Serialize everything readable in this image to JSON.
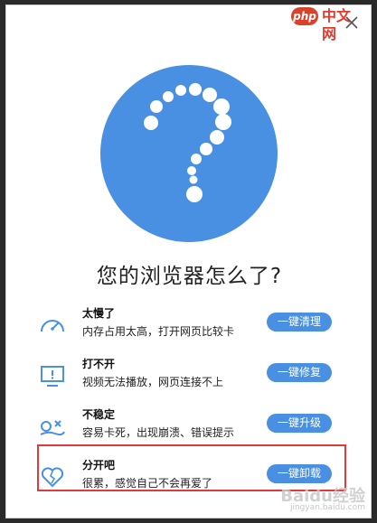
{
  "window": {
    "close_label": "✕"
  },
  "watermark_top": {
    "brand": "php",
    "text": "中文网"
  },
  "title": "您的浏览器怎么了?",
  "items": [
    {
      "name": "太慢了",
      "desc": "内存占用太高，打开网页比较卡",
      "button": "一键清理",
      "icon": "speedometer-icon"
    },
    {
      "name": "打不开",
      "desc": "视频无法播放，网页连接不上",
      "button": "一键修复",
      "icon": "monitor-alert-icon"
    },
    {
      "name": "不稳定",
      "desc": "容易卡死，出现崩溃、错误提示",
      "button": "一键升级",
      "icon": "unstable-icon"
    },
    {
      "name": "分开吧",
      "desc": "很累，感觉自己不会再爱了",
      "button": "一键卸载",
      "icon": "broken-heart-icon"
    }
  ],
  "watermark_bottom": {
    "brand": "Baidu经验",
    "sub": "jingyan.baidu.com"
  },
  "colors": {
    "accent": "#4a90e2",
    "highlight": "#e03a3a"
  }
}
